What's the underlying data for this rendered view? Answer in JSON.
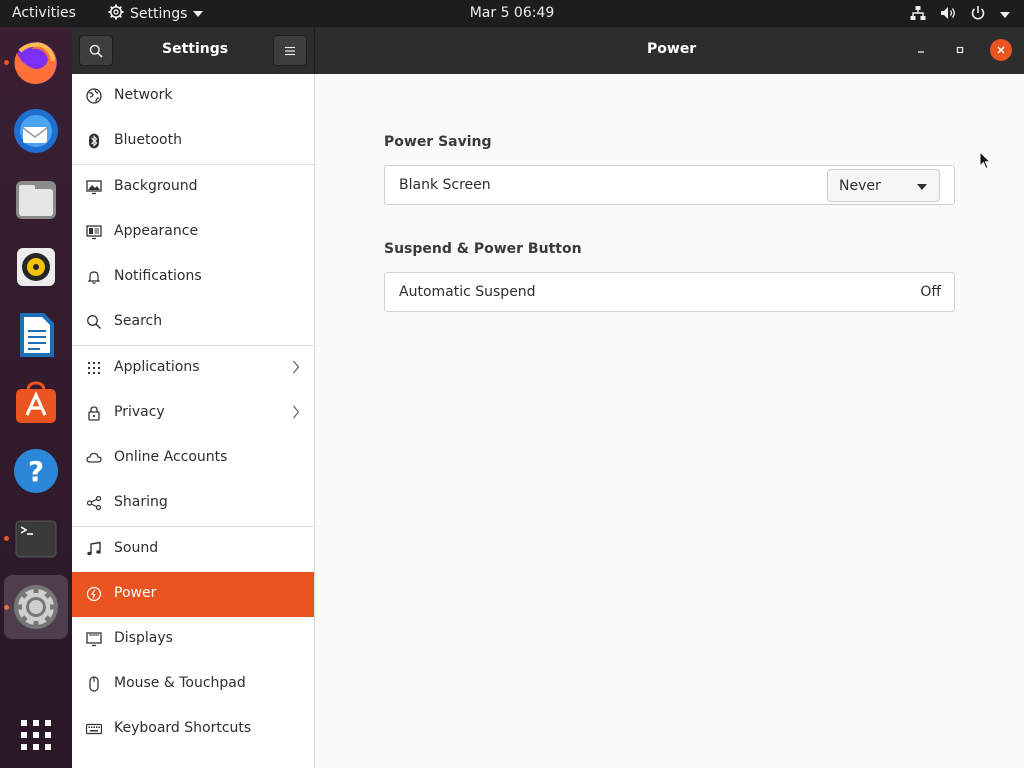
{
  "topbar": {
    "activities": "Activities",
    "app_menu": "Settings",
    "clock": "Mar 5  06:49"
  },
  "dock": {
    "items": [
      "firefox-icon",
      "thunderbird-icon",
      "files-icon",
      "rhythmbox-icon",
      "writer-icon",
      "software-icon",
      "help-icon",
      "terminal-icon",
      "settings-icon",
      "app-grid-icon"
    ]
  },
  "headerbar": {
    "sidebar_title": "Settings",
    "page_title": "Power"
  },
  "sidebar": {
    "items": [
      {
        "label": "Network",
        "icon": "network-icon"
      },
      {
        "label": "Bluetooth",
        "icon": "bluetooth-icon"
      },
      {
        "label": "Background",
        "icon": "background-icon"
      },
      {
        "label": "Appearance",
        "icon": "appearance-icon"
      },
      {
        "label": "Notifications",
        "icon": "bell-icon"
      },
      {
        "label": "Search",
        "icon": "search-icon"
      },
      {
        "label": "Applications",
        "icon": "apps-icon"
      },
      {
        "label": "Privacy",
        "icon": "lock-icon"
      },
      {
        "label": "Online Accounts",
        "icon": "cloud-icon"
      },
      {
        "label": "Sharing",
        "icon": "share-icon"
      },
      {
        "label": "Sound",
        "icon": "music-note-icon"
      },
      {
        "label": "Power",
        "icon": "power-icon"
      },
      {
        "label": "Displays",
        "icon": "display-icon"
      },
      {
        "label": "Mouse & Touchpad",
        "icon": "mouse-icon"
      },
      {
        "label": "Keyboard Shortcuts",
        "icon": "keyboard-icon"
      }
    ],
    "selected": "Power"
  },
  "content": {
    "power_saving": {
      "title": "Power Saving",
      "blank_screen_label": "Blank Screen",
      "blank_screen_value": "Never"
    },
    "suspend": {
      "title": "Suspend & Power Button",
      "automatic_suspend_label": "Automatic Suspend",
      "automatic_suspend_value": "Off"
    }
  },
  "colors": {
    "accent": "#e95420",
    "headerbar": "#2d2d2d",
    "topbar": "#1d1d1d"
  }
}
